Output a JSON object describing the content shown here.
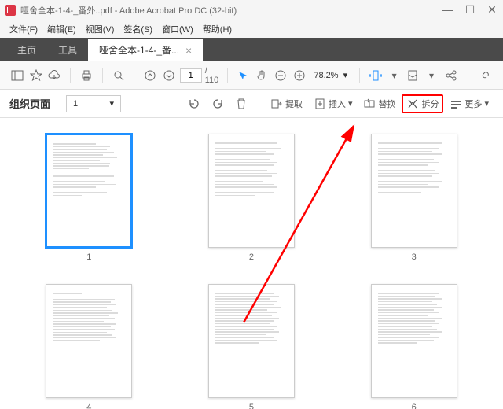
{
  "titlebar": {
    "filename": "哑舍全本-1-4-_番外..pdf",
    "app": "Adobe Acrobat Pro DC (32-bit)"
  },
  "menubar": {
    "file": "文件(F)",
    "edit": "编辑(E)",
    "view": "视图(V)",
    "sign": "签名(S)",
    "window": "窗口(W)",
    "help": "帮助(H)"
  },
  "tabs": {
    "home": "主页",
    "tools": "工具",
    "doc": "哑舍全本-1-4-_番..."
  },
  "toolbar": {
    "page_current": "1",
    "page_total": "/ 110",
    "zoom": "78.2%"
  },
  "panel": {
    "title": "组织页面",
    "pagesel": "1",
    "extract": "提取",
    "insert": "插入",
    "replace": "替换",
    "split": "拆分",
    "more": "更多"
  },
  "thumbs": {
    "p1": "1",
    "p2": "2",
    "p3": "3",
    "p4": "4",
    "p5": "5",
    "p6": "6"
  }
}
